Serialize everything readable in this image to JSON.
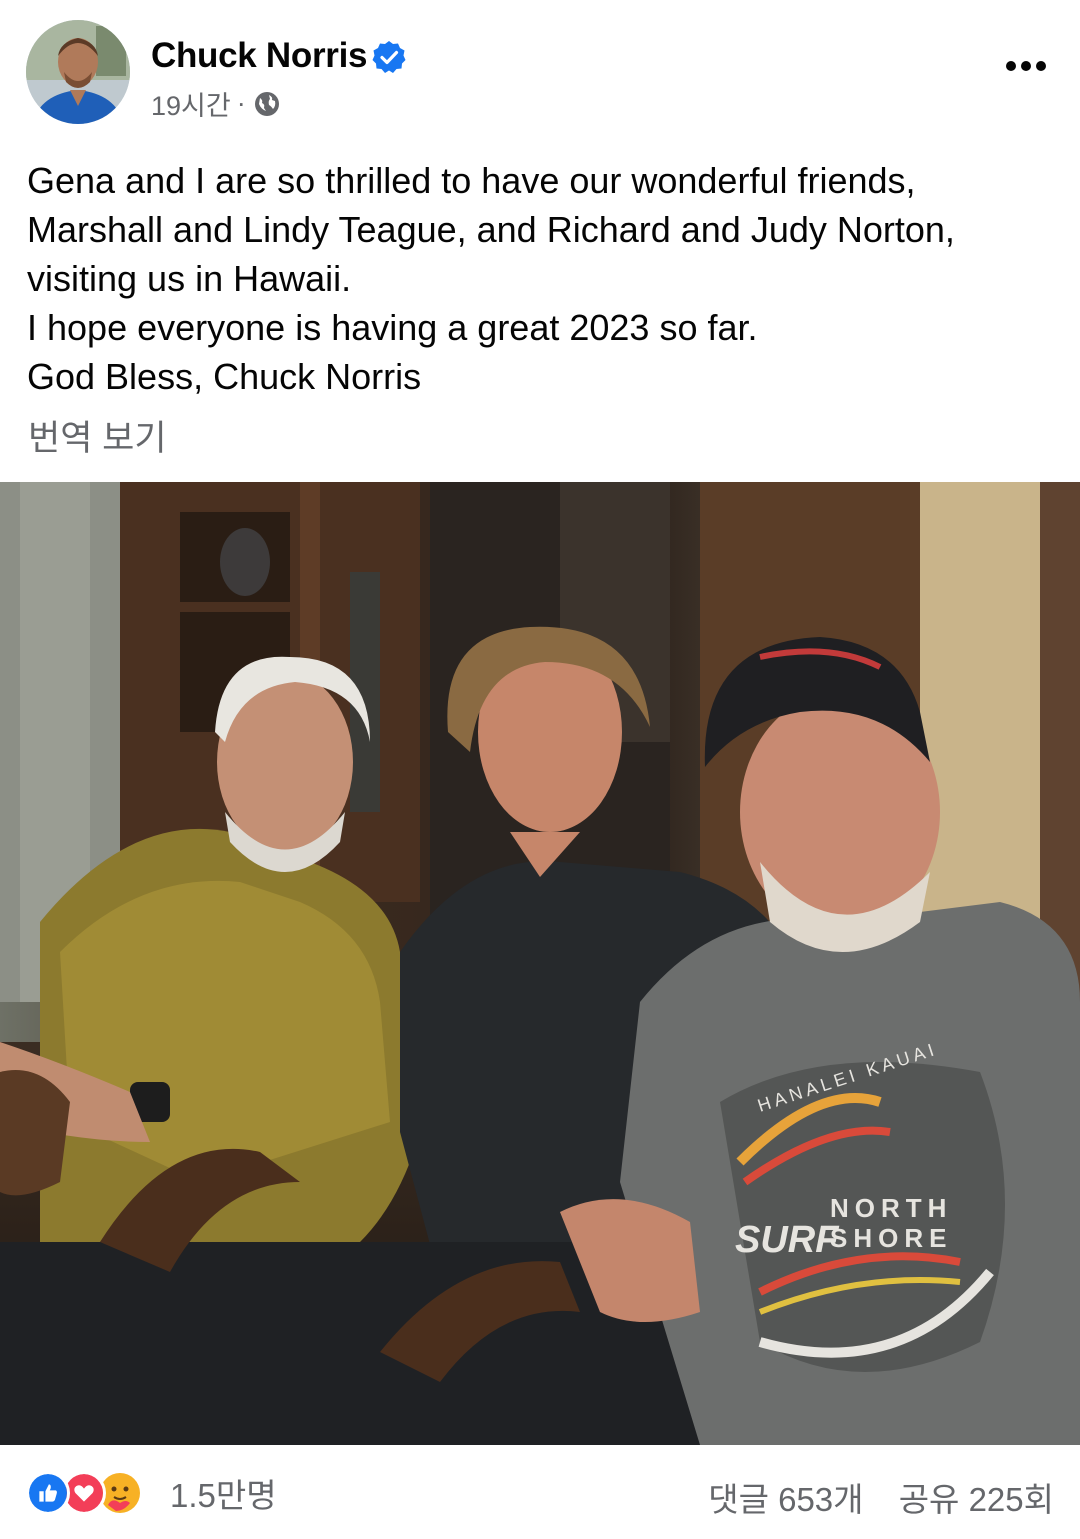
{
  "author": {
    "name": "Chuck Norris",
    "verified": true,
    "time": "19시간",
    "separator": "·",
    "audience_icon": "globe-icon"
  },
  "post": {
    "lines": [
      "Gena and I are so thrilled to have our wonderful friends,",
      "Marshall and Lindy Teague, and Richard and Judy Norton,",
      "visiting us in Hawaii.",
      "I hope everyone is having a great 2023 so far.",
      "God Bless, Chuck Norris"
    ],
    "translate_label": "번역 보기"
  },
  "photo": {
    "shirt_text_1": "NORTH",
    "shirt_text_2": "SHORE",
    "shirt_text_3": "HANALEI KAUAI",
    "shirt_text_4": "SURF"
  },
  "footer": {
    "reaction_icons": [
      "like-icon",
      "love-icon",
      "care-icon"
    ],
    "reaction_count": "1.5만명",
    "comments": "댓글 653개",
    "shares": "공유 225회"
  },
  "colors": {
    "facebook_blue": "#1877f2",
    "love_red": "#f33e58",
    "care_yellow": "#f7b125",
    "secondary_text": "#65676b"
  }
}
